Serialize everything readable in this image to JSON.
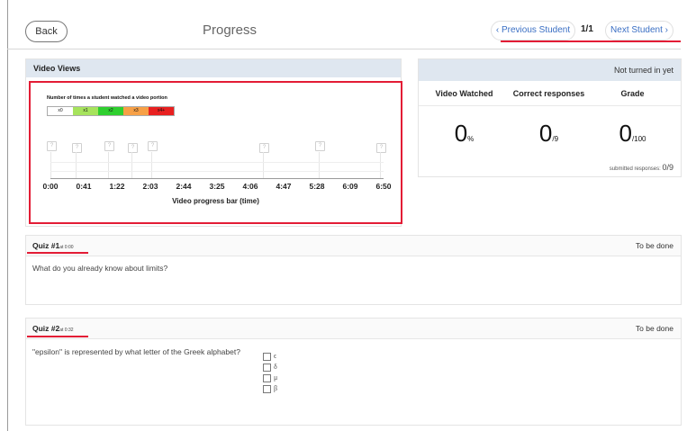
{
  "header": {
    "back_label": "Back",
    "title": "Progress",
    "prev_label": "‹ Previous Student",
    "page_count": "1/1",
    "next_label": "Next Student ›"
  },
  "video_views": {
    "header": "Video Views",
    "chart_title": "Number of times a student watched a video portion",
    "legend": [
      "x0",
      "x1",
      "x2",
      "x3",
      "x4+"
    ],
    "legend_colors": [
      "#ffffff",
      "#a6e35c",
      "#2fcf2f",
      "#f7a046",
      "#e82020"
    ],
    "ticks": [
      "0:00",
      "0:41",
      "1:22",
      "2:03",
      "2:44",
      "3:25",
      "4:06",
      "4:47",
      "5:28",
      "6:09",
      "6:50"
    ],
    "axis_title": "Video progress bar (time)",
    "marker_glyph": "?"
  },
  "stats": {
    "status": "Not turned in yet",
    "video_watched_label": "Video Watched",
    "correct_label": "Correct responses",
    "grade_label": "Grade",
    "video_watched_value": "0",
    "video_watched_unit": "%",
    "correct_value": "0",
    "correct_unit": "/9",
    "grade_value": "0",
    "grade_unit": "/100",
    "submitted_label": "submitted responses:",
    "submitted_value": "0/9"
  },
  "quizzes": [
    {
      "title": "Quiz #1",
      "at": "at 0:00",
      "status": "To be done",
      "question": "What do you already know about limits?"
    },
    {
      "title": "Quiz #2",
      "at": "at 0:32",
      "status": "To be done",
      "question": "\"epsilon\" is represented by what letter of the Greek alphabet?",
      "options": [
        "ϵ",
        "δ",
        "μ",
        "β"
      ]
    }
  ],
  "colors": {
    "accent_red": "#e31c35",
    "link_blue": "#3a6fc4",
    "panel_header": "#dfe7f0"
  }
}
